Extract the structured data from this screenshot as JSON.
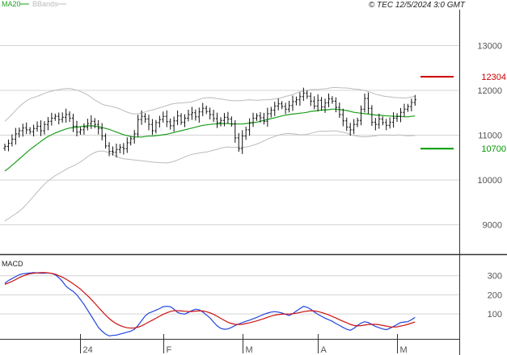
{
  "header": {
    "legend": [
      {
        "label": "MA20",
        "color": "#1a9e1a"
      },
      {
        "label": "BBands",
        "color": "#bbbbbb"
      }
    ],
    "stamp": "© TEC 12/5/2024 3:0 GMT"
  },
  "colors": {
    "ma20": "#1a9e1a",
    "bands": "#bbbbbb",
    "bar": "#111111",
    "resistance": "#cc0000",
    "support": "#009900",
    "macd": "#2244dd",
    "signal": "#cc1111",
    "grid": "#d4d4d4",
    "frame": "#333333"
  },
  "chart_data": [
    {
      "type": "ohlc",
      "y_ticks": [
        90,
        100,
        110,
        120,
        130
      ],
      "y_tick_labels": [
        "9000",
        "10000",
        "11000",
        "12000",
        "13000"
      ],
      "ylim": [
        84,
        138
      ],
      "x_ticks": [
        {
          "label": "24",
          "i": 21
        },
        {
          "label": "F",
          "i": 44
        },
        {
          "label": "M",
          "i": 66
        },
        {
          "label": "A",
          "i": 87
        },
        {
          "label": "M",
          "i": 109
        }
      ],
      "n_points": 115,
      "levels": [
        {
          "value": 123.04,
          "label": "12304",
          "color": "#cc0000"
        },
        {
          "value": 107.0,
          "label": "10700",
          "color": "#009900"
        }
      ],
      "close": [
        107.5,
        108.2,
        109.1,
        110.3,
        111.0,
        111.6,
        111.2,
        110.8,
        111.5,
        112.0,
        111.0,
        112.4,
        113.1,
        113.8,
        114.2,
        113.5,
        114.0,
        114.6,
        113.8,
        112.0,
        110.7,
        111.2,
        111.8,
        112.6,
        113.1,
        112.4,
        111.5,
        109.8,
        107.6,
        106.4,
        106.2,
        106.8,
        107.3,
        107.0,
        108.3,
        109.2,
        110.3,
        113.5,
        114.2,
        113.6,
        112.4,
        111.0,
        112.8,
        113.5,
        114.2,
        113.0,
        112.1,
        113.2,
        114.3,
        112.9,
        113.8,
        114.6,
        115.0,
        114.1,
        115.2,
        116.0,
        115.3,
        114.6,
        113.7,
        112.8,
        113.3,
        114.0,
        113.6,
        112.5,
        109.4,
        107.0,
        109.8,
        111.2,
        112.8,
        113.8,
        114.3,
        113.9,
        113.1,
        114.8,
        115.6,
        116.5,
        117.0,
        116.4,
        115.8,
        116.6,
        117.5,
        117.9,
        118.6,
        119.4,
        118.7,
        117.6,
        116.5,
        117.8,
        116.3,
        117.2,
        118.1,
        117.6,
        116.2,
        114.6,
        113.2,
        111.8,
        111.2,
        112.4,
        113.3,
        115.8,
        118.2,
        116.0,
        112.9,
        112.4,
        113.6,
        112.8,
        112.2,
        112.9,
        113.8,
        114.2,
        115.1,
        115.8,
        116.4,
        117.3,
        117.9
      ],
      "ma20": [
        102.0,
        102.6,
        103.3,
        104.0,
        104.7,
        105.4,
        106.1,
        106.8,
        107.4,
        108.0,
        108.6,
        109.2,
        109.7,
        110.1,
        110.5,
        110.8,
        111.1,
        111.4,
        111.6,
        111.7,
        111.8,
        111.9,
        112.0,
        112.1,
        112.1,
        112.0,
        111.9,
        111.7,
        111.5,
        111.3,
        111.0,
        110.7,
        110.4,
        110.1,
        109.9,
        109.7,
        109.6,
        109.6,
        109.6,
        109.7,
        109.8,
        109.8,
        109.9,
        110.0,
        110.1,
        110.2,
        110.4,
        110.6,
        110.8,
        111.0,
        111.2,
        111.4,
        111.6,
        111.8,
        112.0,
        112.2,
        112.3,
        112.4,
        112.5,
        112.5,
        112.6,
        112.6,
        112.6,
        112.5,
        112.5,
        112.5,
        112.5,
        112.6,
        112.7,
        112.8,
        112.9,
        113.1,
        113.3,
        113.5,
        113.7,
        113.9,
        114.1,
        114.3,
        114.5,
        114.6,
        114.7,
        114.8,
        114.9,
        115.0,
        115.1,
        115.3,
        115.4,
        115.5,
        115.6,
        115.6,
        115.7,
        115.8,
        115.8,
        115.7,
        115.6,
        115.5,
        115.3,
        115.1,
        115.0,
        114.9,
        114.8,
        114.7,
        114.6,
        114.5,
        114.5,
        114.4,
        114.3,
        114.3,
        114.2,
        114.2,
        114.2,
        114.1,
        114.1,
        114.2,
        114.3
      ]
    },
    {
      "type": "line",
      "name": "MACD",
      "y_ticks": [
        100,
        200,
        300
      ],
      "y_tick_labels": [
        "100",
        "200",
        "300"
      ],
      "ylim": [
        -30,
        400
      ],
      "series": [
        {
          "name": "macd",
          "color": "#2244dd",
          "values": [
            260,
            275,
            285,
            295,
            305,
            310,
            312,
            314,
            316,
            314,
            313,
            313,
            315,
            312,
            305,
            290,
            270,
            245,
            230,
            218,
            200,
            175,
            150,
            120,
            90,
            60,
            30,
            10,
            -5,
            -15,
            -12,
            -10,
            -5,
            0,
            5,
            10,
            20,
            40,
            65,
            90,
            105,
            112,
            120,
            128,
            138,
            140,
            138,
            125,
            108,
            102,
            100,
            108,
            118,
            125,
            122,
            110,
            95,
            80,
            58,
            38,
            25,
            20,
            22,
            30,
            40,
            48,
            55,
            62,
            68,
            75,
            82,
            90,
            98,
            105,
            110,
            112,
            110,
            105,
            98,
            92,
            102,
            115,
            128,
            140,
            135,
            125,
            110,
            98,
            88,
            78,
            70,
            62,
            50,
            40,
            30,
            20,
            15,
            25,
            40,
            52,
            60,
            55,
            45,
            35,
            28,
            22,
            18,
            25,
            35,
            45,
            55,
            58,
            60,
            70,
            82
          ]
        },
        {
          "name": "signal",
          "color": "#cc1111",
          "values": [
            255,
            262,
            270,
            280,
            290,
            298,
            305,
            310,
            313,
            315,
            316,
            316,
            315,
            312,
            308,
            300,
            292,
            282,
            270,
            258,
            244,
            230,
            213,
            195,
            176,
            156,
            135,
            114,
            94,
            76,
            61,
            49,
            40,
            33,
            28,
            26,
            27,
            31,
            38,
            48,
            58,
            68,
            78,
            88,
            98,
            106,
            113,
            117,
            117,
            116,
            114,
            113,
            113,
            115,
            116,
            116,
            112,
            106,
            98,
            88,
            77,
            67,
            57,
            50,
            46,
            45,
            46,
            50,
            54,
            59,
            64,
            70,
            76,
            83,
            89,
            94,
            97,
            99,
            100,
            100,
            101,
            104,
            108,
            112,
            115,
            117,
            116,
            113,
            108,
            102,
            95,
            87,
            79,
            70,
            62,
            54,
            46,
            40,
            38,
            39,
            42,
            45,
            46,
            46,
            44,
            40,
            37,
            33,
            32,
            33,
            37,
            41,
            46,
            52,
            58
          ]
        }
      ]
    }
  ]
}
